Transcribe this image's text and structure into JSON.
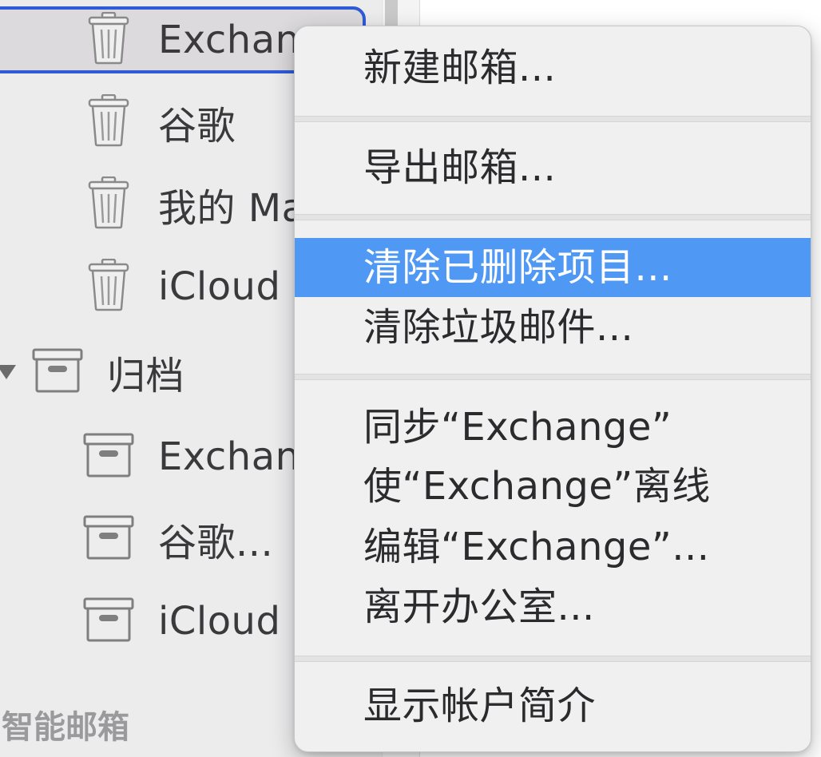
{
  "sidebar": {
    "trash_items": [
      {
        "label": "Exchan",
        "selected": true,
        "icon": "trash-icon"
      },
      {
        "label": "谷歌",
        "selected": false,
        "icon": "trash-icon"
      },
      {
        "label": "我的 Ma",
        "selected": false,
        "icon": "trash-icon"
      },
      {
        "label": "iCloud",
        "selected": false,
        "icon": "trash-icon"
      }
    ],
    "archive_group": {
      "label": "归档",
      "icon": "archive-box-icon",
      "expanded": true
    },
    "archive_items": [
      {
        "label": "Exchan",
        "icon": "archive-box-icon"
      },
      {
        "label": "谷歌...",
        "icon": "archive-box-icon"
      },
      {
        "label": "iCloud",
        "icon": "archive-box-icon"
      }
    ],
    "smart_mailboxes_header": "智能邮箱"
  },
  "context_menu": {
    "groups": [
      [
        {
          "label": "新建邮箱...",
          "highlighted": false
        }
      ],
      [
        {
          "label": "导出邮箱...",
          "highlighted": false
        }
      ],
      [
        {
          "label": "清除已删除项目...",
          "highlighted": true
        },
        {
          "label": "清除垃圾邮件...",
          "highlighted": false
        }
      ],
      [
        {
          "label": "同步“Exchange”",
          "highlighted": false
        },
        {
          "label": "使“Exchange”离线",
          "highlighted": false
        },
        {
          "label": "编辑“Exchange”...",
          "highlighted": false
        },
        {
          "label": "离开办公室...",
          "highlighted": false
        }
      ],
      [
        {
          "label": "显示帐户简介",
          "highlighted": false
        }
      ]
    ]
  },
  "colors": {
    "selection_outline": "#2f5bd7",
    "menu_highlight": "#4f98f3",
    "sidebar_background": "#ececed",
    "menu_background": "#f1f0f1"
  }
}
